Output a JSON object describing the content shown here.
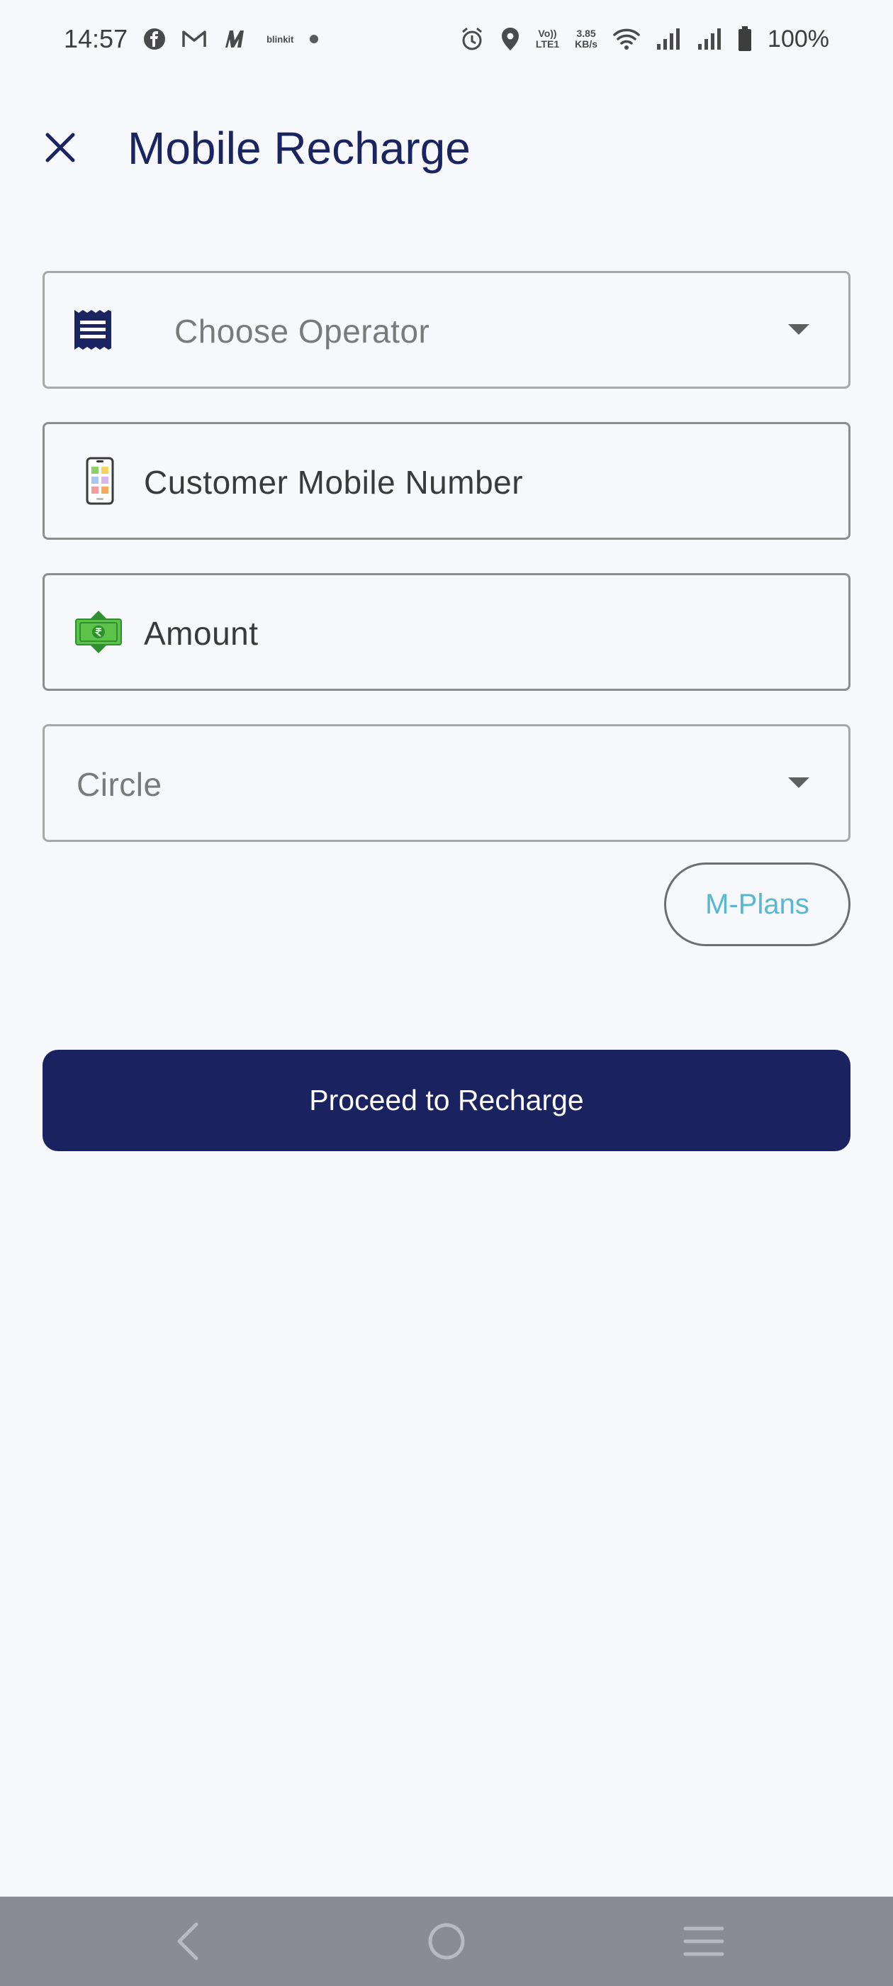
{
  "status_bar": {
    "time": "14:57",
    "app_icons": [
      "facebook-icon",
      "gmail-icon",
      "myntra-icon",
      "blinkit-icon",
      "dot-icon"
    ],
    "blinkit_text": "blinkit",
    "volte_text_top": "Vo))",
    "volte_text_bottom": "LTE1",
    "speed_top": "3.85",
    "speed_bottom": "KB/s",
    "battery_percent": "100%"
  },
  "header": {
    "title": "Mobile Recharge"
  },
  "form": {
    "operator": {
      "placeholder": "Choose Operator",
      "icon": "receipt-icon"
    },
    "mobile": {
      "label": "Customer Mobile Number",
      "icon": "smartphone-icon"
    },
    "amount": {
      "label": "Amount",
      "icon": "rupee-note-icon"
    },
    "circle": {
      "placeholder": "Circle"
    }
  },
  "buttons": {
    "mplans": "M-Plans",
    "proceed": "Proceed to Recharge"
  },
  "colors": {
    "primary": "#1a2260",
    "accent_link": "#58b8d2",
    "background": "#f6f8fc",
    "nav_bar": "#8a8b93"
  }
}
